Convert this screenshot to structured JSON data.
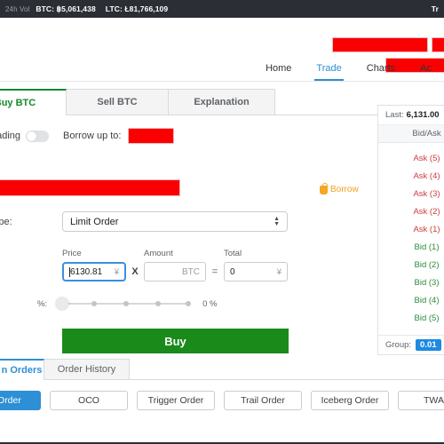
{
  "topbar": {
    "vol_label": "24h Vol",
    "btc": "BTC: ฿5,061,438",
    "ltc": "LTC: Ł81,766,109",
    "right_truncated": "Tr"
  },
  "nav": {
    "items": [
      {
        "label": "Home",
        "active": false
      },
      {
        "label": "Trade",
        "active": true
      },
      {
        "label": "Charts",
        "active": false
      },
      {
        "label": "Ac",
        "active": false
      }
    ]
  },
  "trade_panel": {
    "tabs": [
      {
        "label": "Buy BTC",
        "active": true
      },
      {
        "label": "Sell BTC",
        "active": false
      },
      {
        "label": "Explanation",
        "active": false
      }
    ],
    "margin_label": "rgin trading",
    "borrow_up_to_label": "Borrow up to:",
    "borrow_button_label": "Borrow",
    "order_type_label": "der Type:",
    "order_type_value": "Limit Order",
    "price_caption": "Price",
    "price_value": "6130.81",
    "price_unit": "¥",
    "amount_caption": "Amount",
    "amount_value": "",
    "amount_placeholder": "BTC",
    "total_caption": "Total",
    "total_value": "0",
    "total_unit": "¥",
    "multiply_symbol": "X",
    "equals_symbol": "=",
    "percent_label": "%:",
    "percent_value": "0 %",
    "buy_button": "Buy"
  },
  "order_book": {
    "last_label": "Last:",
    "last_value": "6,131.00",
    "header": "Bid/Ask",
    "rows": [
      {
        "label": "Ask (5)",
        "side": "ask"
      },
      {
        "label": "Ask (4)",
        "side": "ask"
      },
      {
        "label": "Ask (3)",
        "side": "ask"
      },
      {
        "label": "Ask (2)",
        "side": "ask"
      },
      {
        "label": "Ask (1)",
        "side": "ask"
      },
      {
        "label": "Bid (1)",
        "side": "bid"
      },
      {
        "label": "Bid (2)",
        "side": "bid"
      },
      {
        "label": "Bid (3)",
        "side": "bid"
      },
      {
        "label": "Bid (4)",
        "side": "bid"
      },
      {
        "label": "Bid (5)",
        "side": "bid"
      }
    ],
    "group_label": "Group:",
    "group_value": "0.01"
  },
  "bottom": {
    "tabs": [
      {
        "label": "n Orders",
        "active": true
      },
      {
        "label": "Order History",
        "active": false
      }
    ],
    "order_buttons": [
      {
        "label": "mit Order",
        "primary": true
      },
      {
        "label": "OCO",
        "primary": false
      },
      {
        "label": "Trigger Order",
        "primary": false
      },
      {
        "label": "Trail Order",
        "primary": false
      },
      {
        "label": "Iceberg Order",
        "primary": false
      },
      {
        "label": "TWAP",
        "primary": false
      }
    ]
  },
  "colors": {
    "accent_blue": "#2d8fd5",
    "buy_green": "#1a8a1a",
    "ask_red": "#cf3c3c",
    "bid_green": "#2e8b3d",
    "redaction": "#fb0000",
    "topbar_bg": "#2b2f35"
  }
}
